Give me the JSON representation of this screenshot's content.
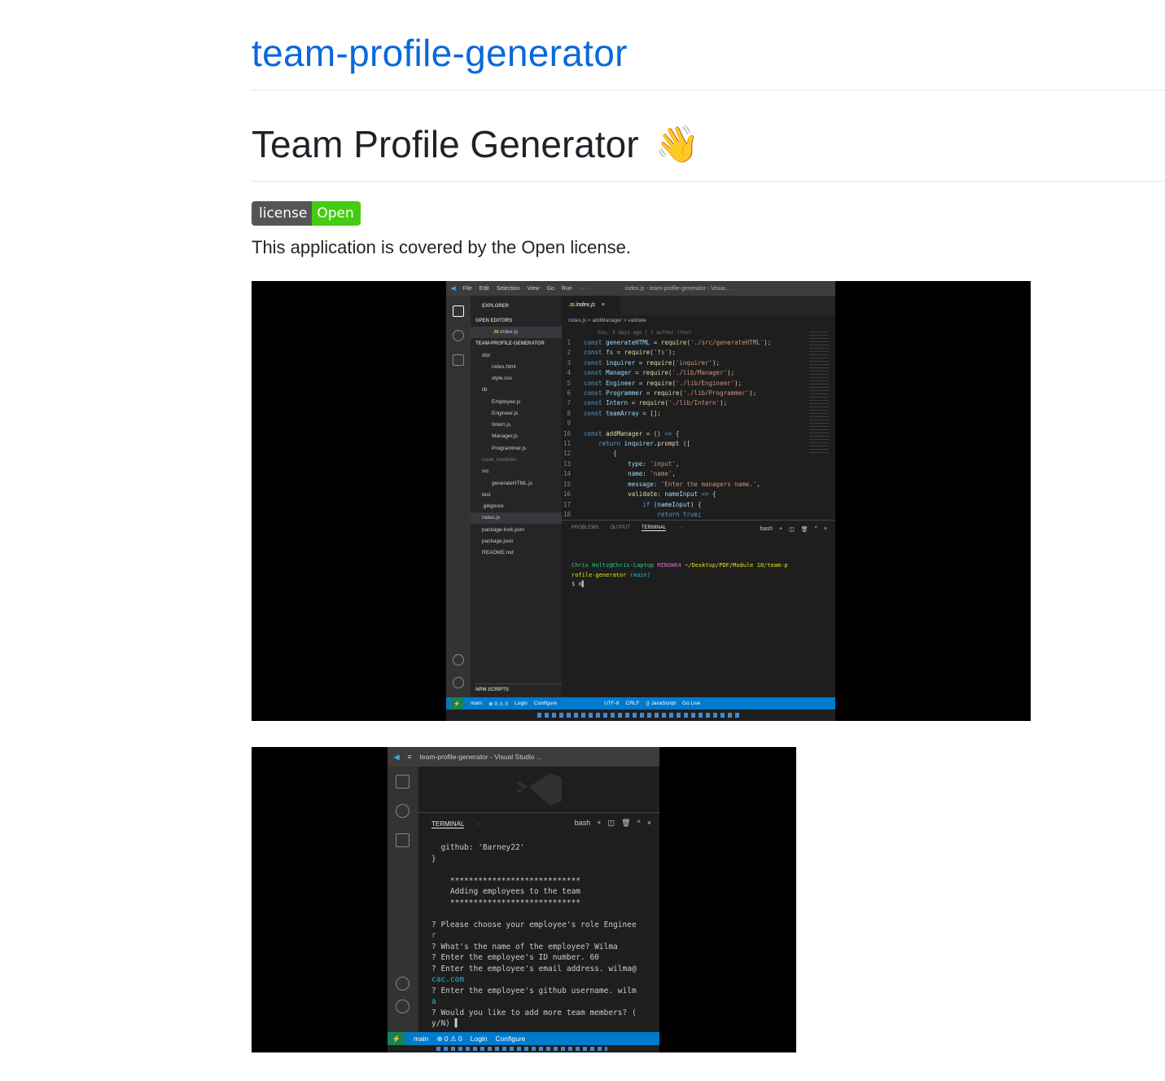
{
  "repo": {
    "title": "team-profile-generator"
  },
  "readme": {
    "heading": "Team Profile Generator",
    "emoji": "👋",
    "badge": {
      "label": "license",
      "value": "Open",
      "label_color": "#555555",
      "value_color": "#44cc11"
    },
    "description": "This application is covered by the Open license."
  },
  "screenshot1": {
    "menu": [
      "File",
      "Edit",
      "Selection",
      "View",
      "Go",
      "Run",
      "···"
    ],
    "window_title": "index.js - team-profile-generator - Visua...",
    "sidebar": {
      "explorer": "EXPLORER",
      "open_editors": "OPEN EDITORS",
      "open_file": "index.js",
      "project": "TEAM-PROFILE-GENERATOR",
      "tree": [
        "dist",
        "index.html",
        "style.css",
        "lib",
        "Employee.js",
        "Engineer.js",
        "Intern.js",
        "Manager.js",
        "Programmer.js",
        "node_modules",
        "src",
        "generateHTML.js",
        "test",
        ".gitignore",
        "index.js",
        "package-lock.json",
        "package.json",
        "README.md"
      ],
      "npm_scripts": "NPM SCRIPTS"
    },
    "tab": "index.js",
    "breadcrumb": "index.js > addManager > validate",
    "blame": "You, 3 days ago | 1 author (You)",
    "code": [
      "const generateHTML = require('./src/generateHTML');",
      "const fs = require('fs');",
      "const inquirer = require('inquirer');",
      "const Manager = require('./lib/Manager');",
      "const Engineer = require('./lib/Engineer');",
      "const Programmer = require('./lib/Programmer');",
      "const Intern = require('./lib/Intern');",
      "const teamArray = [];",
      "",
      "const addManager = () => {",
      "    return inquirer.prompt ([",
      "        {",
      "            type: 'input',",
      "            name: 'name',",
      "            message: 'Enter the managers name.',",
      "            validate: nameInput => {",
      "                if (nameInput) {",
      "                    return true;"
    ],
    "panel_tabs": [
      "PROBLEMS",
      "OUTPUT",
      "TERMINAL",
      "···"
    ],
    "shell": "bash",
    "terminal": {
      "user": "Chris Holtz@Chris-Laptop",
      "env": "MINGW64",
      "path": "~/Desktop/PDF/Module 10/team-p",
      "path2": "rofile-generator",
      "branch": "(main)",
      "prompt": "$ n"
    },
    "status": [
      "main",
      "⊗ 0 ⚠ 0",
      "Login",
      "Configure",
      "UTF-8",
      "CRLF",
      "{} JavaScript",
      "Go Live"
    ]
  },
  "screenshot2": {
    "window_title": "team-profile-generator - Visual Studio ...",
    "panel_tab": "TERMINAL",
    "shell": "bash",
    "terminal": [
      "  github: 'Barney22'",
      "}",
      "",
      "    ****************************",
      "    Adding employees to the team",
      "    ****************************",
      "",
      "? Please choose your employee's role Enginee",
      "r",
      "? What's the name of the employee? Wilma",
      "? Enter the employee's ID number. 60",
      "? Enter the employee's email address. wilma@",
      "cac.com",
      "? Enter the employee's github username. wilm",
      "a",
      "? Would you like to add more team members? (",
      "y/N) ▌"
    ],
    "status": [
      "main",
      "⊗ 0 ⚠ 0",
      "Login",
      "Configure"
    ]
  },
  "colors": {
    "link": "#0969da",
    "vscode_status": "#007acc",
    "badge_green": "#44cc11"
  }
}
